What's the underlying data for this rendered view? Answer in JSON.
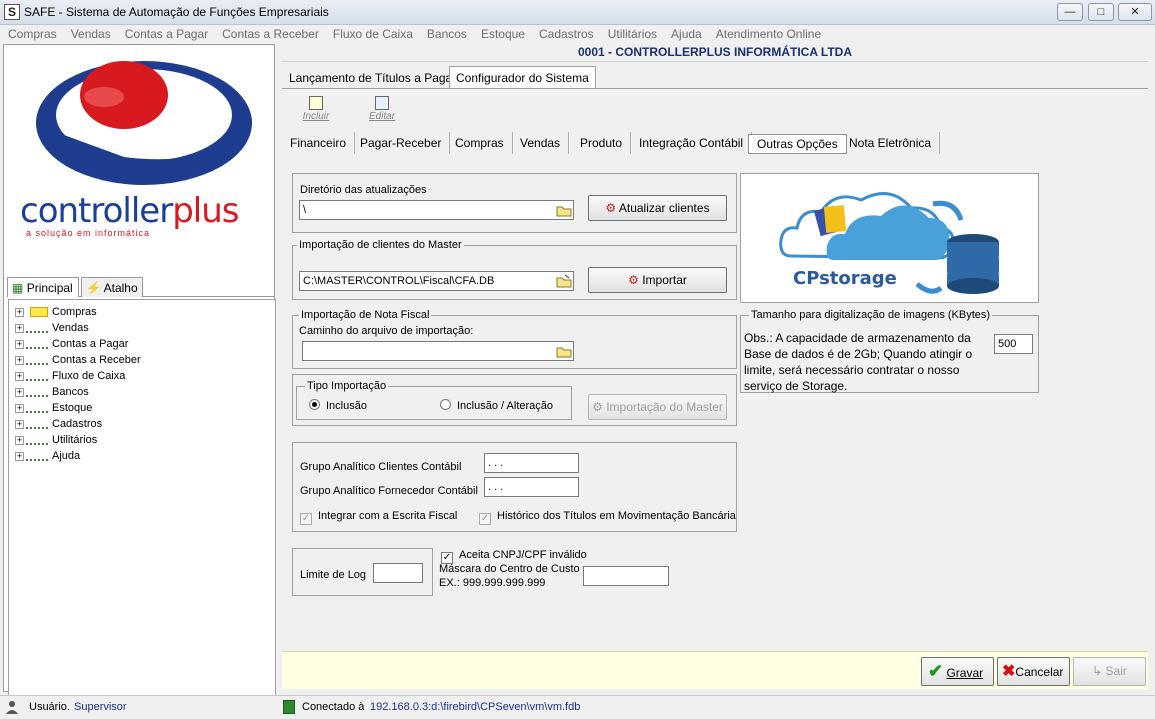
{
  "window": {
    "app_short": "SAFE",
    "title": "SAFE  -  Sistema de Automação de Funções Empresariais"
  },
  "menu": [
    "Compras",
    "Vendas",
    "Contas a Pagar",
    "Contas a Receber",
    "Fluxo de Caixa",
    "Bancos",
    "Estoque",
    "Cadastros",
    "Utilitários",
    "Ajuda",
    "Atendimento Online"
  ],
  "company": "0001 - CONTROLLERPLUS INFORMÁTICA LTDA",
  "logo": {
    "brand_main": "controller",
    "brand_accent": "plus",
    "tagline": "a solução em informática"
  },
  "left_tabs": {
    "principal": "Principal",
    "atalho": "Atalho"
  },
  "tree": [
    "Compras",
    "Vendas",
    "Contas a Pagar",
    "Contas a Receber",
    "Fluxo de Caixa",
    "Bancos",
    "Estoque",
    "Cadastros",
    "Utilitários",
    "Ajuda"
  ],
  "top_tabs": {
    "lancamento": "Lançamento de Títulos a Pagar",
    "configurador": "Configurador do Sistema"
  },
  "toolbar": {
    "incluir": "Incluir",
    "editar": "Editar"
  },
  "sub_tabs": [
    "Financeiro",
    "Pagar-Receber",
    "Compras",
    "Vendas",
    "Produto",
    "Integração Contábil",
    "Outras Opções",
    "Nota Eletrônica"
  ],
  "diretorio": {
    "label": "Diretório das atualizações",
    "value": "\\",
    "button": "Atualizar clientes"
  },
  "importacao_master": {
    "label": "Importação de clientes do Master",
    "value": "C:\\MASTER\\CONTROL\\Fiscal\\CFA.DB",
    "button": "Importar"
  },
  "nota_fiscal": {
    "label": "Importação de Nota Fiscal",
    "path_label": "Caminho do arquivo de importação:",
    "value": ""
  },
  "tipo_importacao": {
    "label": "Tipo Importação",
    "option1": "Inclusão",
    "option2": "Inclusão / Alteração",
    "button": "Importação do Master"
  },
  "storage": {
    "label": "CPstorage"
  },
  "tamanho": {
    "label": "Tamanho para digitalização de imagens (KBytes)",
    "obs": "Obs.: A capacidade de armazenamento da Base de dados é de 2Gb; Quando atingir o limite, será necessário contratar o nosso serviço de Storage.",
    "value": "500"
  },
  "grupos": {
    "clientes_label": "Grupo Analítico Clientes Contábil",
    "clientes_value": ". . .",
    "fornecedor_label": "Grupo Analítico Fornecedor Contábil",
    "fornecedor_value": ". . .",
    "integrar": "Integrar com a Escrita Fiscal",
    "historico": "Histórico dos Títulos em Movimentação Bancária"
  },
  "log": {
    "label": "Limite de Log",
    "value": "",
    "aceita": "Aceita CNPJ/CPF inválido",
    "mascara_label": "Máscara do Centro de Custo",
    "mascara_ex": "EX.: 999.999.999.999",
    "mascara_value": ""
  },
  "actions": {
    "gravar": "Gravar",
    "cancelar": "Cancelar",
    "sair": "Sair"
  },
  "status": {
    "user_label": "Usuário.",
    "user": "Supervisor",
    "conn_label": "Conectado à",
    "conn": "192.168.0.3:d:\\firebird\\CPSeven\\vm\\vm.fdb"
  }
}
